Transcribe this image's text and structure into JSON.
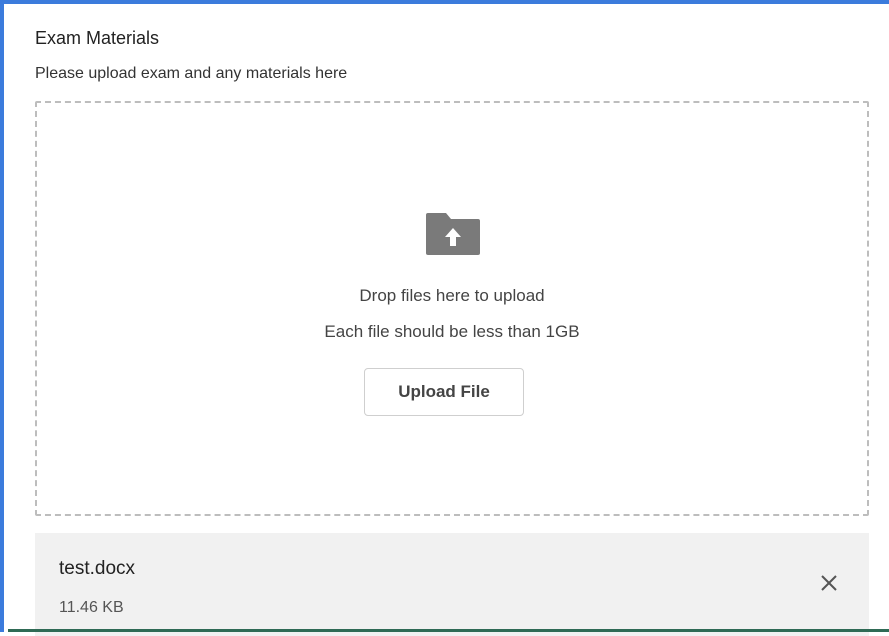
{
  "section": {
    "title": "Exam Materials",
    "subtitle": "Please upload exam and any materials here"
  },
  "dropzone": {
    "icon": "folder-upload-icon",
    "drop_text": "Drop files here to upload",
    "limit_text": "Each file should be less than 1GB",
    "upload_button_label": "Upload File"
  },
  "files": [
    {
      "name": "test.docx",
      "size": "11.46 KB",
      "remove_icon": "close-icon"
    }
  ],
  "colors": {
    "frame_border": "#3b7bdc",
    "icon_gray": "#7a7a7a",
    "file_item_bg": "#f1f1f1"
  }
}
